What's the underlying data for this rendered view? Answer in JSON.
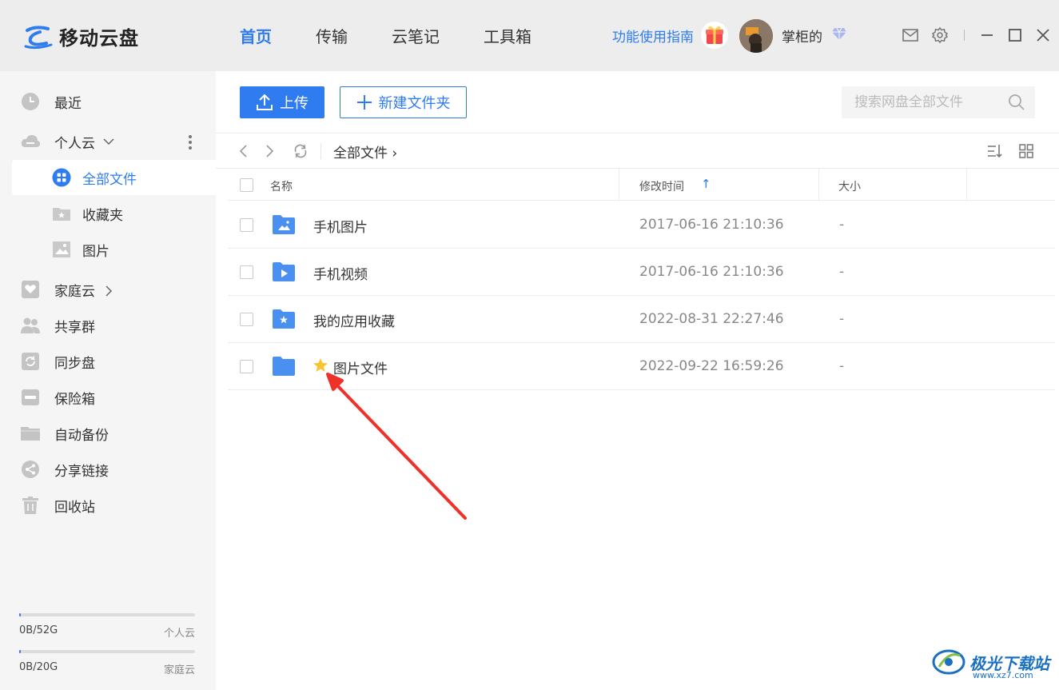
{
  "app": {
    "title": "移动云盘"
  },
  "nav": {
    "tabs": [
      {
        "label": "首页",
        "active": true
      },
      {
        "label": "传输",
        "active": false
      },
      {
        "label": "云笔记",
        "active": false
      },
      {
        "label": "工具箱",
        "active": false
      }
    ],
    "guide_label": "功能使用指南",
    "username": "掌柜的"
  },
  "icons": {
    "logo": "cloud-logo-icon",
    "gift": "gift-icon",
    "vip": "vip-diamond-icon",
    "mail": "mail-icon",
    "settings": "gear-icon",
    "minimize": "minimize-icon",
    "maximize": "maximize-icon",
    "close": "close-icon"
  },
  "colors": {
    "accent": "#2f7cf0",
    "sidebar_bg": "#f5f5f5",
    "topbar_bg": "#ededed",
    "annotation_arrow": "#f0312a",
    "star": "#f7c531"
  },
  "sidebar": {
    "items": [
      {
        "label": "最近",
        "icon": "clock-icon"
      },
      {
        "label": "个人云",
        "icon": "cloud-icon"
      },
      {
        "label": "全部文件",
        "icon": "grid-icon",
        "active": true
      },
      {
        "label": "收藏夹",
        "icon": "star-folder-icon"
      },
      {
        "label": "图片",
        "icon": "image-icon"
      },
      {
        "label": "家庭云",
        "icon": "heart-icon"
      },
      {
        "label": "共享群",
        "icon": "group-icon"
      },
      {
        "label": "同步盘",
        "icon": "sync-icon"
      },
      {
        "label": "保险箱",
        "icon": "safe-icon"
      },
      {
        "label": "自动备份",
        "icon": "folder-icon"
      },
      {
        "label": "分享链接",
        "icon": "share-icon"
      },
      {
        "label": "回收站",
        "icon": "trash-icon"
      }
    ],
    "storage": [
      {
        "used": "0B/52G",
        "label": "个人云",
        "fraction": 0.01
      },
      {
        "used": "0B/20G",
        "label": "家庭云",
        "fraction": 0.01
      }
    ]
  },
  "toolbar": {
    "upload_label": "上传",
    "newfolder_label": "新建文件夹",
    "search_placeholder": "搜索网盘全部文件"
  },
  "breadcrumb": {
    "path": "全部文件 ›"
  },
  "table": {
    "headers": {
      "name": "名称",
      "mtime": "修改时间",
      "size": "大小"
    },
    "sort_indicator": "↑",
    "rows": [
      {
        "name": "手机图片",
        "mtime": "2017-06-16 21:10:36",
        "size": "-",
        "folder_icon": "image-folder-icon",
        "starred": false
      },
      {
        "name": "手机视频",
        "mtime": "2017-06-16 21:10:36",
        "size": "-",
        "folder_icon": "video-folder-icon",
        "starred": false
      },
      {
        "name": "我的应用收藏",
        "mtime": "2022-08-31 22:27:46",
        "size": "-",
        "folder_icon": "star-folder-icon",
        "starred": false
      },
      {
        "name": "图片文件",
        "mtime": "2022-09-22 16:59:26",
        "size": "-",
        "folder_icon": "folder-icon",
        "starred": true
      }
    ]
  },
  "watermark": {
    "text": "极光下载站",
    "url": "www.xz7.com"
  }
}
